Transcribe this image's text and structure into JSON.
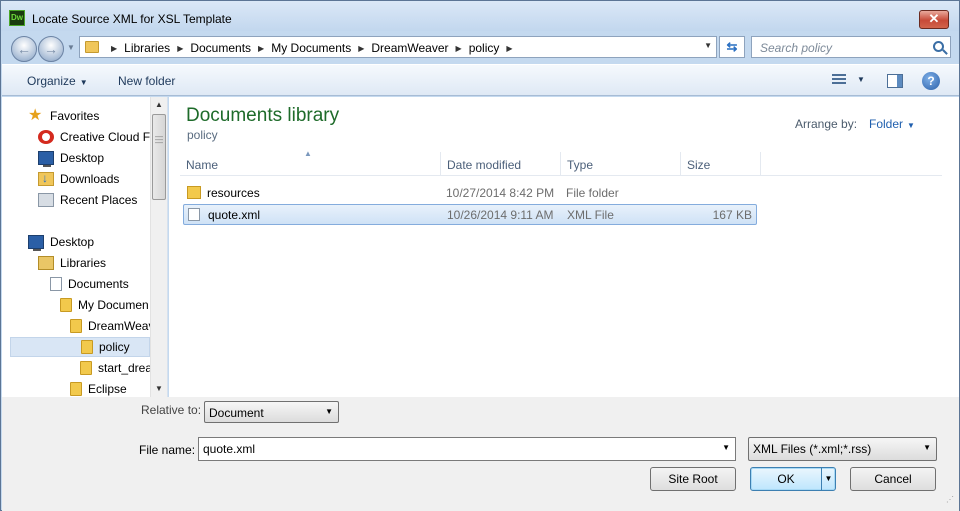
{
  "window": {
    "title": "Locate Source XML for XSL Template",
    "app_icon_text": "Dw",
    "close_glyph": "✕"
  },
  "nav": {
    "back_glyph": "←",
    "forward_glyph": "→",
    "breadcrumbs": [
      "Libraries",
      "Documents",
      "My Documents",
      "DreamWeaver",
      "policy"
    ],
    "refresh_glyph": "⇆",
    "search_placeholder": "Search policy"
  },
  "toolbar": {
    "organize_label": "Organize",
    "new_folder_label": "New folder",
    "help_glyph": "?"
  },
  "sidebar": {
    "items": [
      {
        "label": "Favorites",
        "icon": "star-icon"
      },
      {
        "label": "Creative Cloud Fi",
        "icon": "creative-cloud-icon"
      },
      {
        "label": "Desktop",
        "icon": "desktop-icon"
      },
      {
        "label": "Downloads",
        "icon": "downloads-icon"
      },
      {
        "label": "Recent Places",
        "icon": "recent-places-icon"
      },
      {
        "label": "Desktop",
        "icon": "desktop-icon"
      },
      {
        "label": "Libraries",
        "icon": "libraries-icon"
      },
      {
        "label": "Documents",
        "icon": "documents-icon"
      },
      {
        "label": "My Documen",
        "icon": "folder-icon"
      },
      {
        "label": "DreamWeav",
        "icon": "folder-icon"
      },
      {
        "label": "policy",
        "icon": "folder-icon",
        "selected": true
      },
      {
        "label": "start_drea",
        "icon": "folder-icon"
      },
      {
        "label": "Eclipse",
        "icon": "folder-icon"
      }
    ]
  },
  "main": {
    "library_title": "Documents library",
    "library_subtitle": "policy",
    "arrange_by_label": "Arrange by:",
    "arrange_by_value": "Folder",
    "columns": [
      "Name",
      "Date modified",
      "Type",
      "Size"
    ],
    "files": [
      {
        "name": "resources",
        "date": "10/27/2014 8:42 PM",
        "type": "File folder",
        "size": "",
        "icon": "folder-icon"
      },
      {
        "name": "quote.xml",
        "date": "10/26/2014 9:11 AM",
        "type": "XML File",
        "size": "167 KB",
        "icon": "xml-file-icon",
        "selected": true
      }
    ]
  },
  "footer": {
    "relative_to_label": "Relative to:",
    "relative_to_value": "Document",
    "file_name_label": "File name:",
    "file_name_value": "quote.xml",
    "filter_value": "XML Files (*.xml;*.rss)",
    "site_root_label": "Site Root",
    "ok_label": "OK",
    "cancel_label": "Cancel"
  }
}
